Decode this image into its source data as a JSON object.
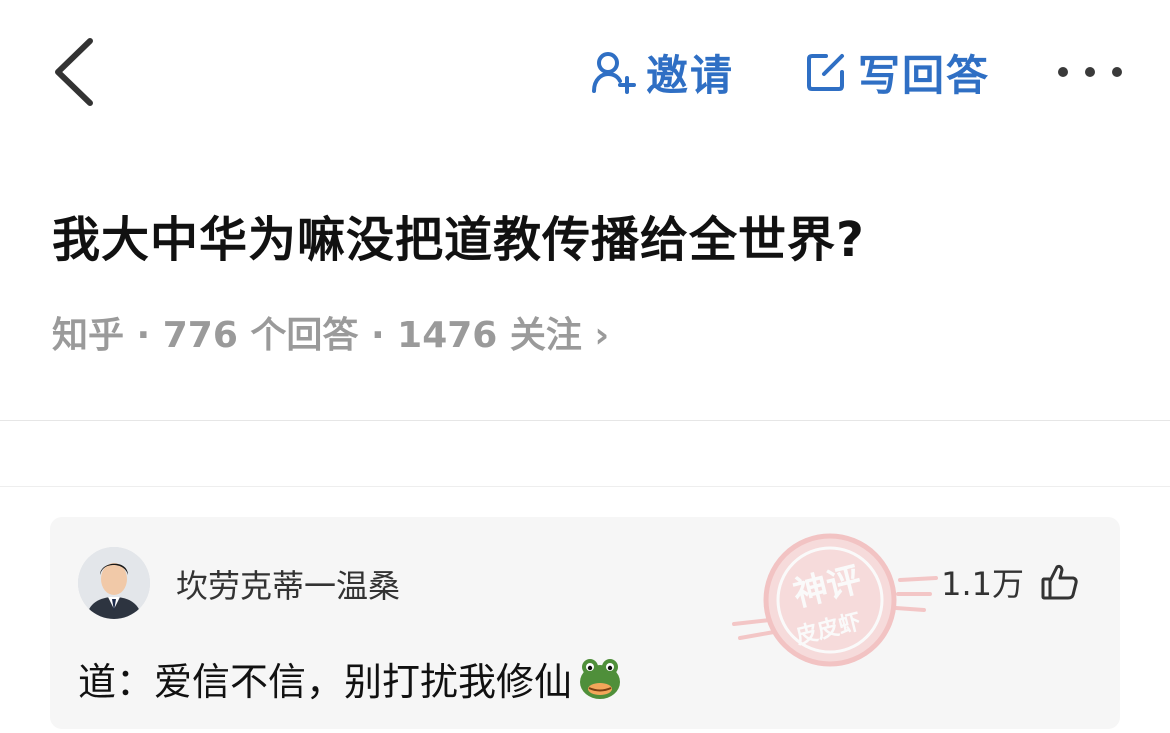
{
  "header": {
    "back_icon": "chevron-left-icon",
    "invite_label": "邀请",
    "invite_icon": "add-user-icon",
    "write_label": "写回答",
    "write_icon": "edit-square-icon",
    "more_icon": "more-dots-icon",
    "accent_color": "#2f6fc4"
  },
  "question": {
    "title": "我大中华为嘛没把道教传播给全世界?",
    "meta": "知乎 · 776 个回答 · 1476 关注 ›"
  },
  "comment": {
    "author": "坎劳克蒂一温桑",
    "likes": "1.1万",
    "like_icon": "thumbs-up-icon",
    "text": "道：爱信不信，别打扰我修仙",
    "emoji": "frog-face-emoji"
  },
  "watermark": {
    "line1": "神评",
    "line2": "皮皮虾"
  }
}
